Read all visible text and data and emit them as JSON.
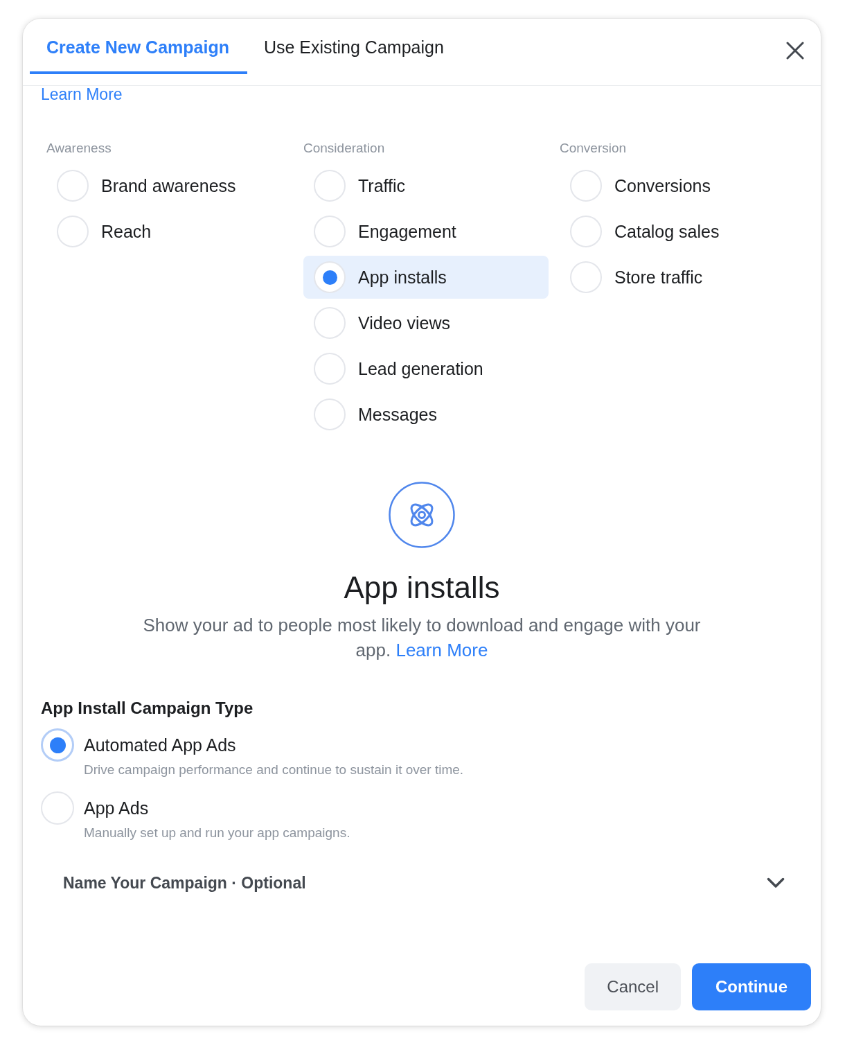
{
  "dialog": {
    "tabs": [
      {
        "label": "Create New Campaign",
        "selected": true
      },
      {
        "label": "Use Existing Campaign",
        "selected": false
      }
    ],
    "learn_more_link": "Learn More",
    "objective_groups": [
      {
        "heading": "Awareness",
        "options": [
          {
            "label": "Brand awareness",
            "selected": false
          },
          {
            "label": "Reach",
            "selected": false
          }
        ]
      },
      {
        "heading": "Consideration",
        "options": [
          {
            "label": "Traffic",
            "selected": false
          },
          {
            "label": "Engagement",
            "selected": false
          },
          {
            "label": "App installs",
            "selected": true
          },
          {
            "label": "Video views",
            "selected": false
          },
          {
            "label": "Lead generation",
            "selected": false
          },
          {
            "label": "Messages",
            "selected": false
          }
        ]
      },
      {
        "heading": "Conversion",
        "options": [
          {
            "label": "Conversions",
            "selected": false
          },
          {
            "label": "Catalog sales",
            "selected": false
          },
          {
            "label": "Store traffic",
            "selected": false
          }
        ]
      }
    ],
    "objective_detail": {
      "title": "App installs",
      "description": "Show your ad to people most likely to download and engage with your app.",
      "link": "Learn More"
    },
    "campaign_type": {
      "heading": "App Install Campaign Type",
      "options": [
        {
          "label": "Automated App Ads",
          "description": "Drive campaign performance and continue to sustain it over time.",
          "selected": true
        },
        {
          "label": "App Ads",
          "description": "Manually set up and run your app campaigns.",
          "selected": false
        }
      ]
    },
    "campaign_name_section": {
      "title": "Name Your Campaign · Optional"
    },
    "buttons": [
      {
        "label": "Cancel",
        "kind": "secondary"
      },
      {
        "label": "Continue",
        "kind": "primary"
      }
    ]
  }
}
